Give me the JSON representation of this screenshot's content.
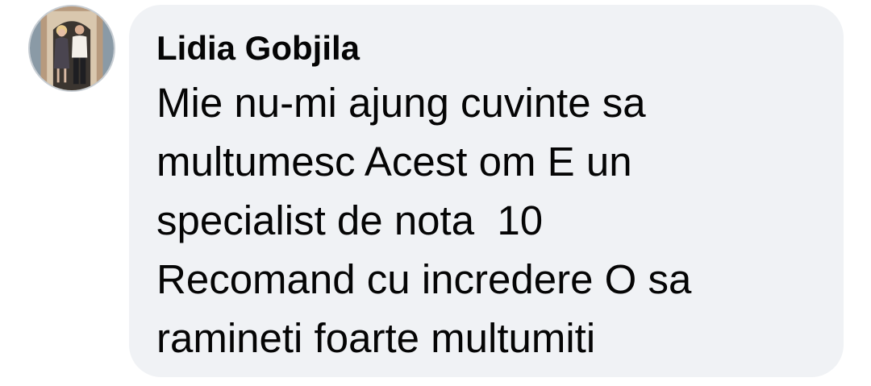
{
  "comment": {
    "avatar_icon": "profile-photo-couple",
    "author": "Lidia Gobjila",
    "lines": [
      "Mie nu-mi ajung cuvinte sa",
      "multumesc Acest om E un",
      "specialist de nota  10",
      "Recomand cu incredere O sa",
      "ramineti foarte multumiti"
    ]
  },
  "colors": {
    "bubble_background": "#f0f2f5",
    "text": "#050505",
    "page_background": "#ffffff"
  }
}
